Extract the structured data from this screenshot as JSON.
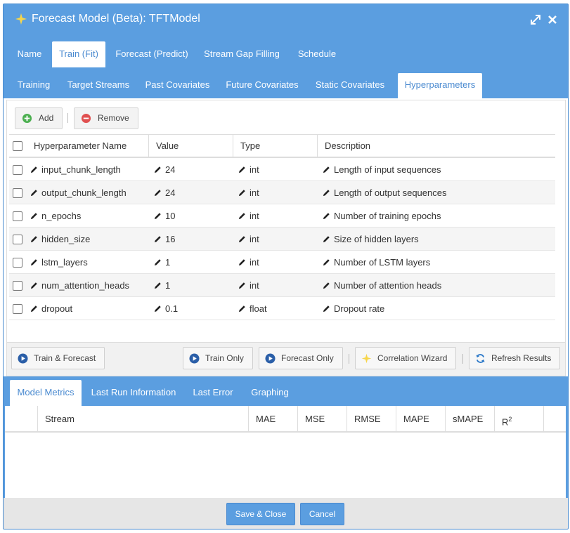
{
  "window": {
    "title": "Forecast Model (Beta): TFTModel",
    "title_icon": "sparkle-icon",
    "controls": [
      "expand-icon",
      "close-icon"
    ]
  },
  "main_tabs": [
    {
      "label": "Name",
      "active": false
    },
    {
      "label": "Train (Fit)",
      "active": true
    },
    {
      "label": "Forecast (Predict)",
      "active": false
    },
    {
      "label": "Stream Gap Filling",
      "active": false
    },
    {
      "label": "Schedule",
      "active": false
    }
  ],
  "sub_tabs": [
    {
      "label": "Training",
      "active": false
    },
    {
      "label": "Target Streams",
      "active": false
    },
    {
      "label": "Past Covariates",
      "active": false
    },
    {
      "label": "Future Covariates",
      "active": false
    },
    {
      "label": "Static Covariates",
      "active": false
    },
    {
      "label": "Hyperparameters",
      "active": true
    }
  ],
  "toolbar": {
    "add_label": "Add",
    "remove_label": "Remove"
  },
  "grid": {
    "columns": [
      "Hyperparameter Name",
      "Value",
      "Type",
      "Description"
    ],
    "rows": [
      {
        "name": "input_chunk_length",
        "value": "24",
        "type": "int",
        "description": "Length of input sequences"
      },
      {
        "name": "output_chunk_length",
        "value": "24",
        "type": "int",
        "description": "Length of output sequences"
      },
      {
        "name": "n_epochs",
        "value": "10",
        "type": "int",
        "description": "Number of training epochs"
      },
      {
        "name": "hidden_size",
        "value": "16",
        "type": "int",
        "description": "Size of hidden layers"
      },
      {
        "name": "lstm_layers",
        "value": "1",
        "type": "int",
        "description": "Number of LSTM layers"
      },
      {
        "name": "num_attention_heads",
        "value": "1",
        "type": "int",
        "description": "Number of attention heads"
      },
      {
        "name": "dropout",
        "value": "0.1",
        "type": "float",
        "description": "Dropout rate"
      }
    ]
  },
  "actions": {
    "train_forecast": "Train & Forecast",
    "train_only": "Train Only",
    "forecast_only": "Forecast Only",
    "correlation_wizard": "Correlation Wizard",
    "refresh_results": "Refresh Results"
  },
  "results_tabs": [
    {
      "label": "Model Metrics",
      "active": true
    },
    {
      "label": "Last Run Information",
      "active": false
    },
    {
      "label": "Last Error",
      "active": false
    },
    {
      "label": "Graphing",
      "active": false
    }
  ],
  "metrics": {
    "columns": [
      "Stream",
      "MAE",
      "MSE",
      "RMSE",
      "MAPE",
      "sMAPE"
    ],
    "r2_base": "R",
    "r2_sup": "2"
  },
  "footer": {
    "save_close": "Save & Close",
    "cancel": "Cancel"
  },
  "colors": {
    "primary": "#5b9ee0",
    "active_tab_text": "#4a8ad0",
    "add_icon": "#4caf50",
    "remove_icon": "#e05050",
    "star_icon": "#f7d64a"
  }
}
